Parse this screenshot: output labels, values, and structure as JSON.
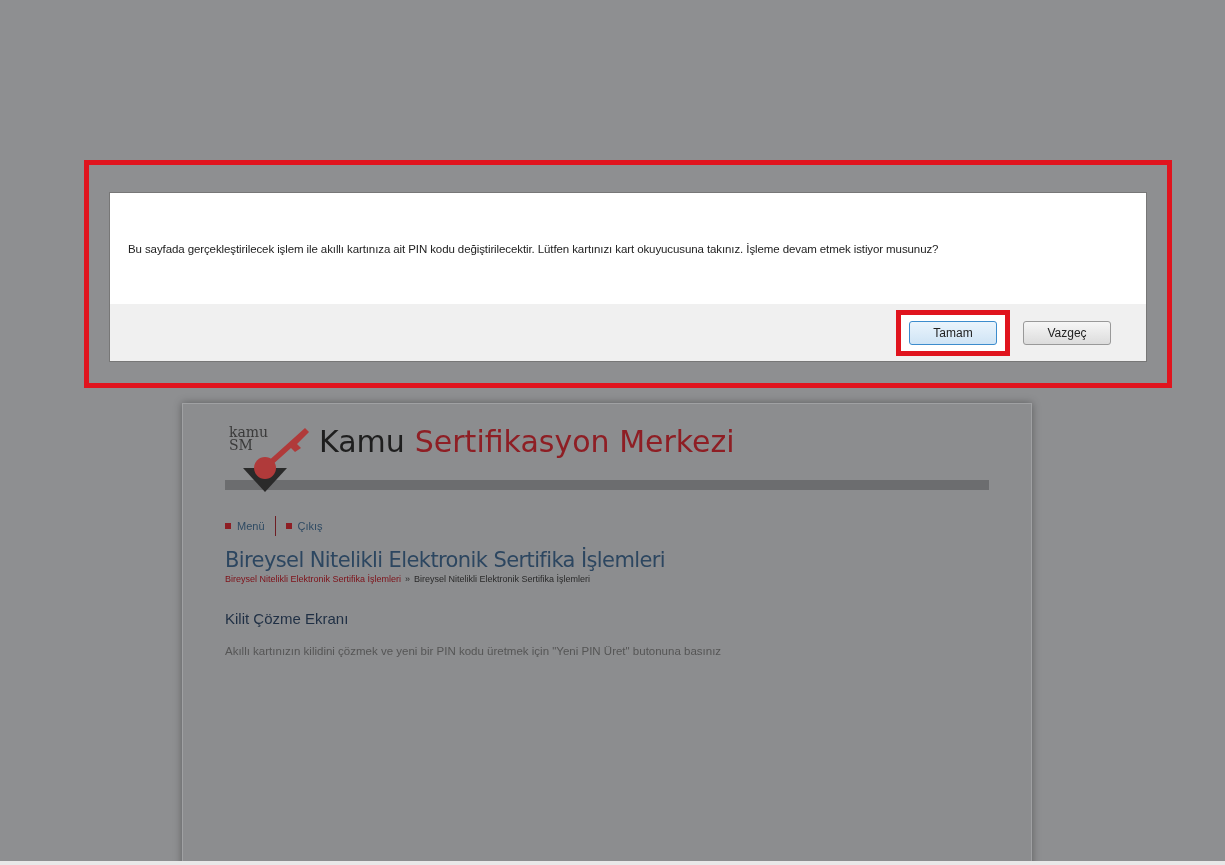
{
  "dialog": {
    "message": "Bu sayfada gerçekleştirilecek işlem ile akıllı kartınıza ait PIN kodu değiştirilecektir. Lütfen kartınızı kart okuyucusuna takınız. İşleme devam etmek istiyor musunuz?",
    "buttons": [
      {
        "label": "Tamam",
        "highlighted": true
      },
      {
        "label": "Vazgeç",
        "highlighted": false
      }
    ]
  },
  "page": {
    "logo": {
      "line_1": "kamu",
      "line_2": "SM"
    },
    "site_title": {
      "first": "Kamu",
      "rest": "Sertifikasyon Merkezi"
    },
    "nav": [
      "Menü",
      "Çıkış"
    ],
    "heading": "Bireysel Nitelikli Elektronik Sertifika İşlemleri",
    "breadcrumb": [
      {
        "label": "Bireysel Nitelikli Elektronik Sertifika İşlemleri",
        "kind": "link"
      },
      {
        "label": "»",
        "kind": "separator"
      },
      {
        "label": "Bireysel Nitelikli Elektronik Sertifika İşlemleri",
        "kind": "current"
      }
    ],
    "section_title": "Kilit Çözme Ekranı",
    "instructions": "Akıllı kartınızın kilidini çözmek ve yeni bir PIN kodu üretmek için \"Yeni PIN Üret\" butonuna basınız"
  }
}
